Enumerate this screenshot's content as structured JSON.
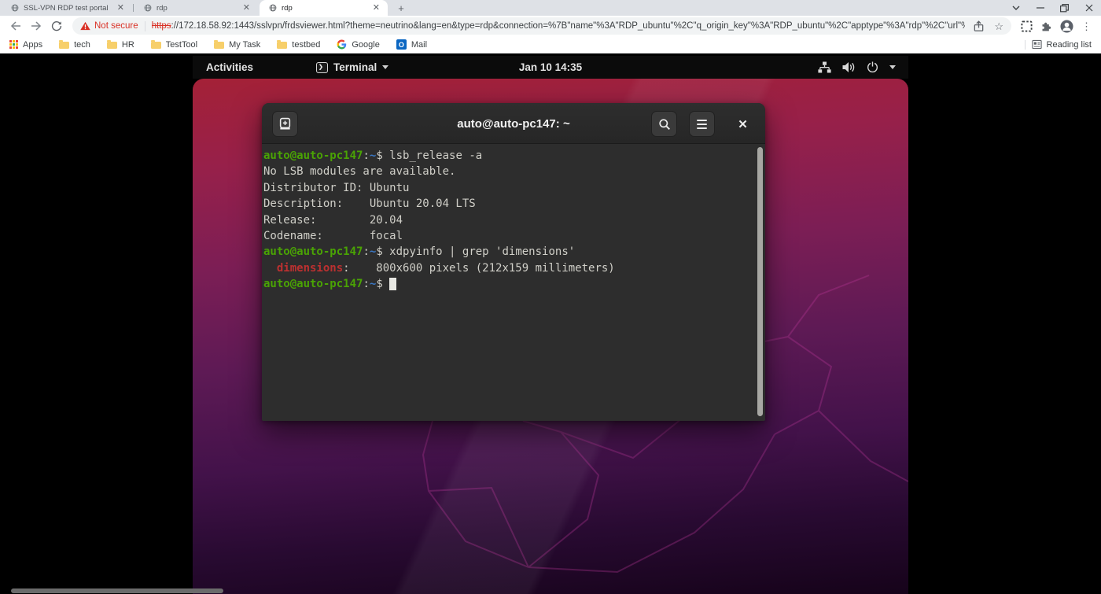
{
  "browser": {
    "tabs": [
      {
        "title": "SSL-VPN RDP test portal"
      },
      {
        "title": "rdp"
      },
      {
        "title": "rdp"
      }
    ],
    "new_tab_label": "+",
    "toolbar": {
      "security_label": "Not secure",
      "url_scheme": "https",
      "url_rest": "://172.18.58.92:1443/sslvpn/frdsviewer.html?theme=neutrino&lang=en&type=rdp&connection=%7B\"name\"%3A\"RDP_ubuntu\"%2C\"q_origin_key\"%3A\"RDP_ubuntu\"%2C\"apptype\"%3A\"rdp\"%2C\"url\"%3A\"\"%2C\"host\"%3A\"172.18.58.10..."
    },
    "bookmarks_bar": {
      "items": [
        {
          "icon": "apps-grid",
          "label": "Apps"
        },
        {
          "icon": "folder",
          "label": "tech"
        },
        {
          "icon": "folder",
          "label": "HR"
        },
        {
          "icon": "folder",
          "label": "TestTool"
        },
        {
          "icon": "folder",
          "label": "My Task"
        },
        {
          "icon": "folder",
          "label": "testbed"
        },
        {
          "icon": "google-g",
          "label": "Google"
        },
        {
          "icon": "outlook",
          "label": "Mail",
          "icon_text": "O"
        }
      ],
      "reading_list_label": "Reading list"
    }
  },
  "desktop": {
    "topbar": {
      "activities_label": "Activities",
      "app_name": "Terminal",
      "clock": "Jan 10 14:35"
    },
    "terminal": {
      "title": "auto@auto-pc147: ~",
      "lines": [
        {
          "segments": [
            {
              "c": "g",
              "t": "auto@auto-pc147"
            },
            {
              "c": "f",
              "t": ":"
            },
            {
              "c": "b",
              "t": "~"
            },
            {
              "c": "f",
              "t": "$ lsb_release -a"
            }
          ]
        },
        {
          "segments": [
            {
              "c": "f",
              "t": "No LSB modules are available."
            }
          ]
        },
        {
          "segments": [
            {
              "c": "f",
              "t": "Distributor ID: Ubuntu"
            }
          ]
        },
        {
          "segments": [
            {
              "c": "f",
              "t": "Description:    Ubuntu 20.04 LTS"
            }
          ]
        },
        {
          "segments": [
            {
              "c": "f",
              "t": "Release:        20.04"
            }
          ]
        },
        {
          "segments": [
            {
              "c": "f",
              "t": "Codename:       focal"
            }
          ]
        },
        {
          "segments": [
            {
              "c": "g",
              "t": "auto@auto-pc147"
            },
            {
              "c": "f",
              "t": ":"
            },
            {
              "c": "b",
              "t": "~"
            },
            {
              "c": "f",
              "t": "$ xdpyinfo | grep 'dimensions'"
            }
          ]
        },
        {
          "segments": [
            {
              "c": "f",
              "t": "  "
            },
            {
              "c": "r",
              "t": "dimensions"
            },
            {
              "c": "f",
              "t": ":    800x600 pixels (212x159 millimeters)"
            }
          ]
        },
        {
          "segments": [
            {
              "c": "g",
              "t": "auto@auto-pc147"
            },
            {
              "c": "f",
              "t": ":"
            },
            {
              "c": "b",
              "t": "~"
            },
            {
              "c": "f",
              "t": "$ "
            },
            {
              "c": "cursor",
              "t": " "
            }
          ]
        }
      ]
    }
  },
  "colors": {
    "not_secure_red": "#d93025",
    "prompt_green": "#4aa304",
    "path_blue": "#3b78c4",
    "grep_match_red": "#bc3030",
    "terminal_bg": "#2d2d2d",
    "terminal_fg": "#d0cfc8",
    "wallpaper_top": "#a42137",
    "wallpaper_bottom": "#16031a"
  }
}
